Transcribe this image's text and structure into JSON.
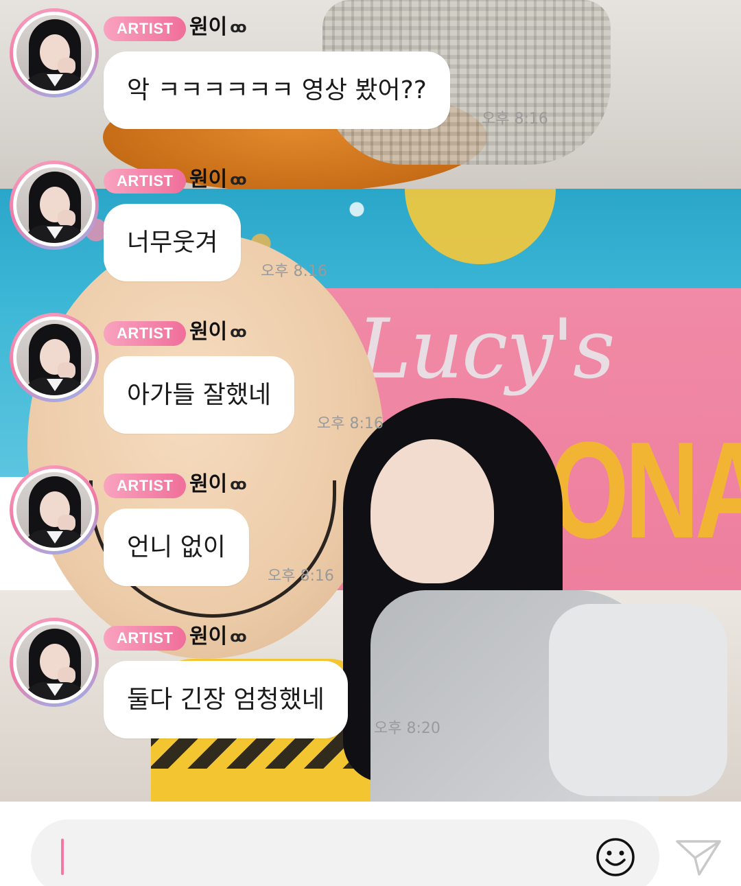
{
  "messages": [
    {
      "badge": "ARTIST",
      "name": "원이",
      "name_deco": "ꝏ",
      "text": "악 ㅋㅋㅋㅋㅋㅋ 영상 봤어??",
      "time": "오후 8:16"
    },
    {
      "badge": "ARTIST",
      "name": "원이",
      "name_deco": "ꝏ",
      "text": "너무웃겨",
      "time": "오후 8:16"
    },
    {
      "badge": "ARTIST",
      "name": "원이",
      "name_deco": "ꝏ",
      "text": "아가들 잘했네",
      "time": "오후 8:16"
    },
    {
      "badge": "ARTIST",
      "name": "원이",
      "name_deco": "ꝏ",
      "text": "언니 없이",
      "time": "오후 8:16"
    },
    {
      "badge": "ARTIST",
      "name": "원이",
      "name_deco": "ꝏ",
      "text": "둘다 긴장 엄청했네",
      "time": "오후 8:20"
    }
  ],
  "input": {
    "placeholder": "",
    "value": ""
  },
  "icons": {
    "emoji": "smiley-icon",
    "send": "paper-plane-icon"
  },
  "colors": {
    "accent": "#f07aa5",
    "badge_start": "#f9a2bf",
    "badge_end": "#f06f9a"
  }
}
